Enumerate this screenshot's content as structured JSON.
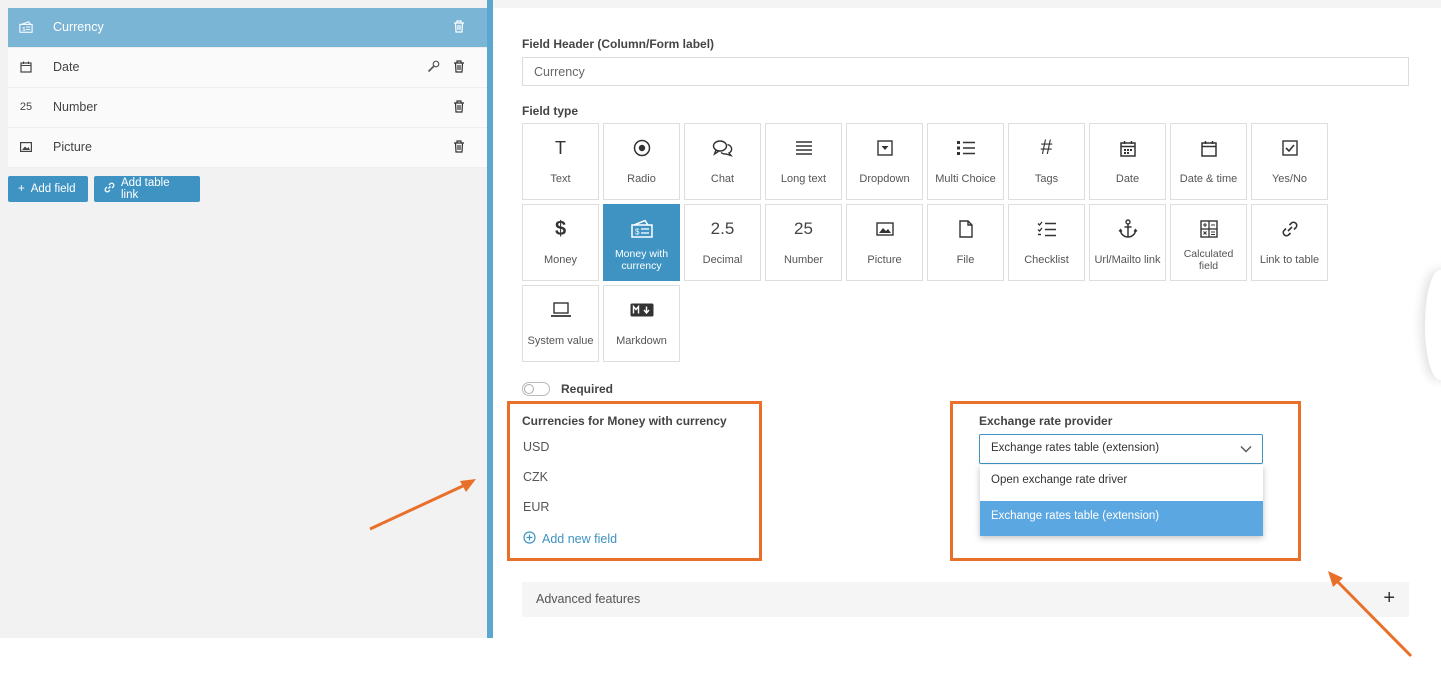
{
  "sidebar": {
    "fields": [
      {
        "label": "Currency",
        "icon": "money-currency-icon"
      },
      {
        "label": "Date",
        "icon": "calendar-icon"
      },
      {
        "label": "Number",
        "icon": "number-icon",
        "glyph": "25"
      },
      {
        "label": "Picture",
        "icon": "picture-icon"
      }
    ],
    "add_field": "Add field",
    "add_table_link": "Add table link"
  },
  "form": {
    "header_label": "Field Header (Column/Form label)",
    "header_value": "Currency",
    "type_label": "Field type",
    "types": [
      {
        "label": "Text",
        "glyph": "T"
      },
      {
        "label": "Radio"
      },
      {
        "label": "Chat"
      },
      {
        "label": "Long text"
      },
      {
        "label": "Dropdown"
      },
      {
        "label": "Multi Choice"
      },
      {
        "label": "Tags",
        "glyph": "#"
      },
      {
        "label": "Date"
      },
      {
        "label": "Date & time"
      },
      {
        "label": "Yes/No"
      },
      {
        "label": "Money",
        "glyph": "$"
      },
      {
        "label": "Money with currency",
        "selected": true
      },
      {
        "label": "Decimal",
        "glyph": "2.5"
      },
      {
        "label": "Number",
        "glyph": "25"
      },
      {
        "label": "Picture"
      },
      {
        "label": "File"
      },
      {
        "label": "Checklist"
      },
      {
        "label": "Url/Mailto link"
      },
      {
        "label": "Calculated field"
      },
      {
        "label": "Link to table"
      },
      {
        "label": "System value"
      },
      {
        "label": "Markdown"
      }
    ],
    "required_label": "Required",
    "required_on": false,
    "currencies_label": "Currencies for Money with currency",
    "currencies": [
      "USD",
      "CZK",
      "EUR"
    ],
    "add_new_field": "Add new field",
    "provider_label": "Exchange rate provider",
    "provider_value": "Exchange rates table (extension)",
    "provider_options": [
      "Open exchange rate driver",
      "Exchange rates table (extension)"
    ],
    "advanced_label": "Advanced features"
  },
  "colors": {
    "accent": "#3e93c2",
    "highlight": "#e8702a",
    "active_row": "#7ab5d6"
  }
}
